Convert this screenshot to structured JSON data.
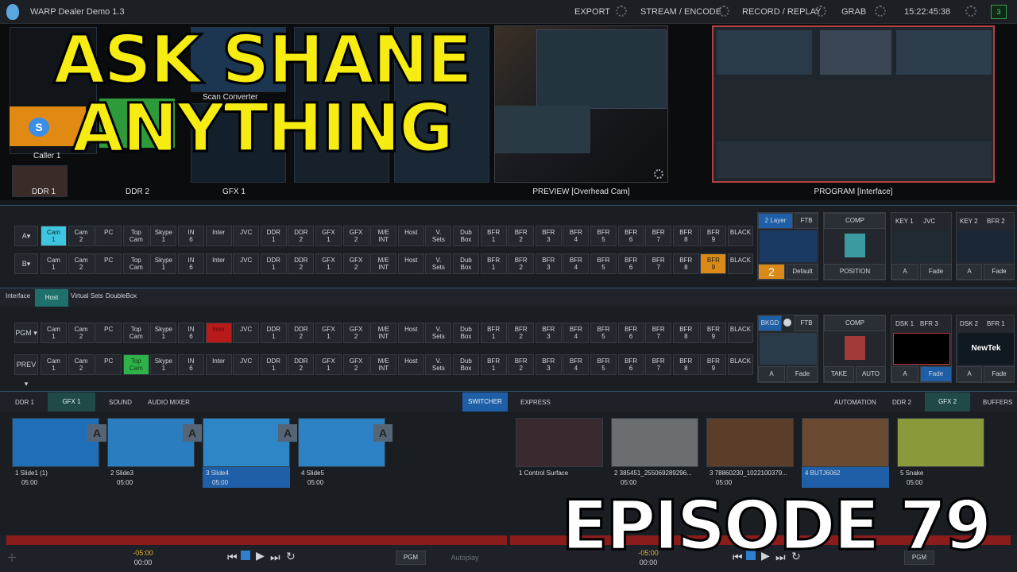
{
  "app": {
    "title": "WARP Dealer Demo 1.3",
    "clock": "15:22:45:38",
    "notif": "3"
  },
  "menu": {
    "export": "EXPORT",
    "stream": "STREAM / ENCODE",
    "record": "RECORD / REPLAY",
    "grab": "GRAB"
  },
  "overlay": {
    "title": "ASK SHANE ANYTHING",
    "episode": "EPISODE 79"
  },
  "monitors": {
    "caller": "Caller 1",
    "ddr": "DDR 1",
    "ddr2": "DDR 2",
    "gfx": "GFX 1",
    "scan": "Scan Converter",
    "preview_label": "PREVIEW [Overhead Cam]",
    "program_label": "PROGRAM [Interface]"
  },
  "me_rows": [
    {
      "label": "A▾",
      "buttons": [
        "Cam\n1",
        "Cam\n2",
        "PC",
        "Top\nCam",
        "Skype\n1",
        "IN\n6",
        "Inter",
        "JVC",
        "DDR\n1",
        "DDR\n2",
        "GFX\n1",
        "GFX\n2",
        "M/E\nINT",
        "Host",
        "V.\nSets",
        "Dub\nBox",
        "BFR\n1",
        "BFR\n2",
        "BFR\n3",
        "BFR\n4",
        "BFR\n5",
        "BFR\n6",
        "BFR\n7",
        "BFR\n8",
        "BFR\n9",
        "BLACK"
      ],
      "active": 0,
      "active_color": "blue"
    },
    {
      "label": "B▾",
      "buttons": [
        "Cam\n1",
        "Cam\n2",
        "PC",
        "Top\nCam",
        "Skype\n1",
        "IN\n6",
        "Inter",
        "JVC",
        "DDR\n1",
        "DDR\n2",
        "GFX\n1",
        "GFX\n2",
        "M/E\nINT",
        "Host",
        "V.\nSets",
        "Dub\nBox",
        "BFR\n1",
        "BFR\n2",
        "BFR\n3",
        "BFR\n4",
        "BFR\n5",
        "BFR\n6",
        "BFR\n7",
        "BFR\n8",
        "BFR\n9",
        "BLACK"
      ],
      "active": 24,
      "active_color": "orange"
    },
    {
      "label": "PGM ▾",
      "buttons": [
        "Cam\n1",
        "Cam\n2",
        "PC",
        "Top\nCam",
        "Skype\n1",
        "IN\n6",
        "Inter",
        "JVC",
        "DDR\n1",
        "DDR\n2",
        "GFX\n1",
        "GFX\n2",
        "M/E\nINT",
        "Host",
        "V.\nSets",
        "Dub\nBox",
        "BFR\n1",
        "BFR\n2",
        "BFR\n3",
        "BFR\n4",
        "BFR\n5",
        "BFR\n6",
        "BFR\n7",
        "BFR\n8",
        "BFR\n9",
        "BLACK"
      ],
      "active": 6,
      "active_color": "red"
    },
    {
      "label": "PREV ▾",
      "buttons": [
        "Cam\n1",
        "Cam\n2",
        "PC",
        "Top\nCam",
        "Skype\n1",
        "IN\n6",
        "Inter",
        "JVC",
        "DDR\n1",
        "DDR\n2",
        "GFX\n1",
        "GFX\n2",
        "M/E\nINT",
        "Host",
        "V.\nSets",
        "Dub\nBox",
        "BFR\n1",
        "BFR\n2",
        "BFR\n3",
        "BFR\n4",
        "BFR\n5",
        "BFR\n6",
        "BFR\n7",
        "BFR\n8",
        "BFR\n9",
        "BLACK"
      ],
      "active": 3,
      "active_color": "green"
    }
  ],
  "me_controls": {
    "layer": "2 Layer",
    "ftb": "FTB",
    "comp": "COMP",
    "key1": "KEY 1",
    "key1src": "JVC",
    "key2": "KEY 2",
    "key2src": "BFR 2",
    "two": "2",
    "default": "Default",
    "position": "POSITION",
    "fade": "Fade",
    "a": "A"
  },
  "main_controls": {
    "bkgd": "BKGD",
    "ftb": "FTB",
    "comp": "COMP",
    "take": "TAKE",
    "auto": "AUTO",
    "dsk1": "DSK 1",
    "dsk1src": "BFR 3",
    "dsk2": "DSK 2",
    "dsk2src": "BFR 1",
    "fade": "Fade",
    "newtek": "NewTek"
  },
  "me_tabs": {
    "interface": "Interface",
    "host": "Host",
    "vsets": "Virtual Sets",
    "doublebox": "DoubleBox"
  },
  "media_tabs": {
    "ddr1": "DDR 1",
    "gfx1": "GFX 1",
    "sound": "SOUND",
    "audio": "AUDIO MIXER",
    "switcher": "SWITCHER",
    "express": "EXPRESS",
    "automation": "AUTOMATION",
    "ddr2": "DDR 2",
    "gfx2": "GFX 2",
    "buffers": "BUFFERS"
  },
  "left_playlist": [
    {
      "name": "1  Slide1 (1)",
      "dur": "05:00"
    },
    {
      "name": "2  Slide3",
      "dur": "05:00"
    },
    {
      "name": "3  Slide4",
      "dur": "05:00"
    },
    {
      "name": "4  Slide5",
      "dur": "05:00"
    }
  ],
  "right_playlist": [
    {
      "name": "1  Control Surface",
      "dur": ""
    },
    {
      "name": "2  385451_255069289296...",
      "dur": "05:00"
    },
    {
      "name": "3  78860230_1022100379...",
      "dur": "05:00"
    },
    {
      "name": "4  BUTJ6062",
      "dur": ""
    },
    {
      "name": "5  Snake",
      "dur": "05:00"
    }
  ],
  "transport": {
    "left_time": "-05:00",
    "left_time2": "00:00",
    "right_time": "-05:00",
    "right_time2": "00:00",
    "pgm": "PGM",
    "autoplay": "Autoplay"
  },
  "colors": {
    "accent": "#3ec6e0",
    "active_orange": "#d98a18",
    "active_red": "#b91a1a",
    "active_green": "#2fb24a",
    "title_yellow": "#f6ec12"
  }
}
